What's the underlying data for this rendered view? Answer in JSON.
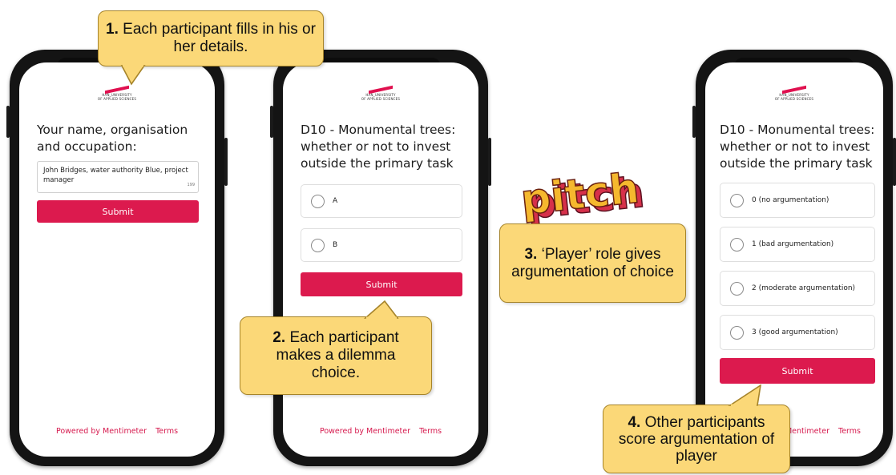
{
  "phones": [
    {
      "logo_lines": [
        "HAN_UNIVERSITY",
        "OF APPLIED SCIENCES"
      ],
      "question": "Your name, organisation and occupation:",
      "answer_text": "John Bridges, water authority Blue, project manager",
      "char_counter": "199",
      "submit_label": "Submit",
      "footer_powered": "Powered by Mentimeter",
      "footer_terms": "Terms"
    },
    {
      "logo_lines": [
        "HAN_UNIVERSITY",
        "OF APPLIED SCIENCES"
      ],
      "question": "D10 - Monumental trees: whether or not to invest outside the primary task",
      "options": [
        "A",
        "B"
      ],
      "submit_label": "Submit",
      "footer_powered": "Powered by Mentimeter",
      "footer_terms": "Terms"
    },
    {
      "logo_lines": [
        "HAN_UNIVERSITY",
        "OF APPLIED SCIENCES"
      ],
      "question": "D10 - Monumental trees: whether or not to invest outside the primary task",
      "options": [
        "0 (no argumentation)",
        "1 (bad argumentation)",
        "2 (moderate argumentation)",
        "3 (good argumentation)"
      ],
      "submit_label": "Submit",
      "footer_powered": "Mentimeter",
      "footer_terms": "Terms"
    }
  ],
  "pitch_logo_text": "pitch",
  "callouts": [
    {
      "number": "1.",
      "text": "Each participant fills in his or her details."
    },
    {
      "number": "2.",
      "text": "Each participant makes a dilemma choice."
    },
    {
      "number": "3.",
      "text": "‘Player’ role gives argumentation of choice"
    },
    {
      "number": "4.",
      "text": "Other participants score argumentation of player"
    }
  ],
  "colors": {
    "accent": "#dc1a4e",
    "callout_fill": "#fbd878",
    "callout_border": "#a6842a",
    "phone_frame": "#141414",
    "pitch_fill": "#f5b82e",
    "pitch_side": "#d6304a"
  }
}
